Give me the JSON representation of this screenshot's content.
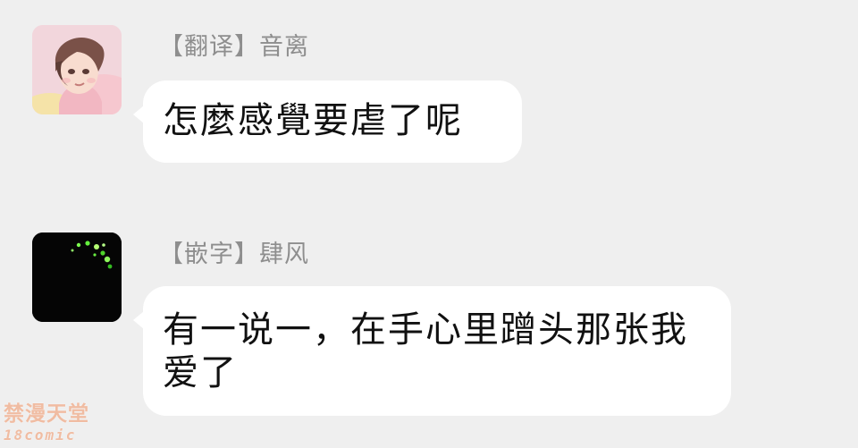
{
  "messages": [
    {
      "avatar_icon": "anime-boy-avatar-icon",
      "sender": "【翻译】音离",
      "text": "怎麼感覺要虐了呢"
    },
    {
      "avatar_icon": "fireflies-avatar-icon",
      "sender": "【嵌字】肆风",
      "text": "有一说一，在手心里蹭头那张我爱了"
    }
  ],
  "watermark": {
    "line1": "禁漫天堂",
    "line2": "18comic"
  },
  "colors": {
    "background": "#efefef",
    "bubble": "#ffffff",
    "sender_text": "#8e8e8e",
    "message_text": "#111111",
    "watermark": "#f1b79a"
  }
}
